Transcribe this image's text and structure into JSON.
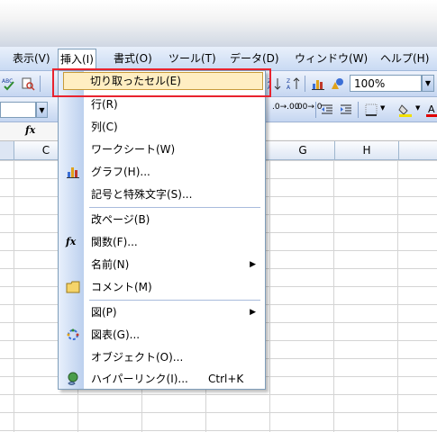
{
  "menubar": {
    "items": [
      {
        "label": "表示(V)"
      },
      {
        "label": "挿入(I)"
      },
      {
        "label": "書式(O)"
      },
      {
        "label": "ツール(T)"
      },
      {
        "label": "データ(D)"
      },
      {
        "label": "ウィンドウ(W)"
      },
      {
        "label": "ヘルプ(H)"
      }
    ]
  },
  "toolbar": {
    "zoom": "100%",
    "toggle_labels": [
      ".0→.00",
      ".00→.0"
    ]
  },
  "formula_bar": {
    "fx": "fx"
  },
  "columns": [
    "C",
    "G",
    "H"
  ],
  "insert_menu": {
    "items": [
      {
        "label": "切り取ったセル(E)",
        "icon": "cut-cells-icon",
        "highlighted": true
      },
      {
        "label": "行(R)",
        "icon": ""
      },
      {
        "label": "列(C)",
        "icon": ""
      },
      {
        "label": "ワークシート(W)",
        "icon": ""
      },
      {
        "label": "グラフ(H)...",
        "icon": "chart-icon"
      },
      {
        "label": "記号と特殊文字(S)...",
        "icon": ""
      },
      {
        "label": "改ページ(B)",
        "icon": ""
      },
      {
        "label": "関数(F)...",
        "icon": "function-icon"
      },
      {
        "label": "名前(N)",
        "icon": "",
        "submenu": true
      },
      {
        "label": "コメント(M)",
        "icon": "comment-icon"
      },
      {
        "label": "図(P)",
        "icon": "",
        "submenu": true
      },
      {
        "label": "図表(G)...",
        "icon": "diagram-icon"
      },
      {
        "label": "オブジェクト(O)...",
        "icon": ""
      },
      {
        "label": "ハイパーリンク(I)...",
        "icon": "hyperlink-icon",
        "shortcut": "Ctrl+K"
      }
    ]
  },
  "colors": {
    "highlight": "#ffeec2",
    "annotation_border": "#e8232f",
    "menubar": "#c9daf3"
  }
}
